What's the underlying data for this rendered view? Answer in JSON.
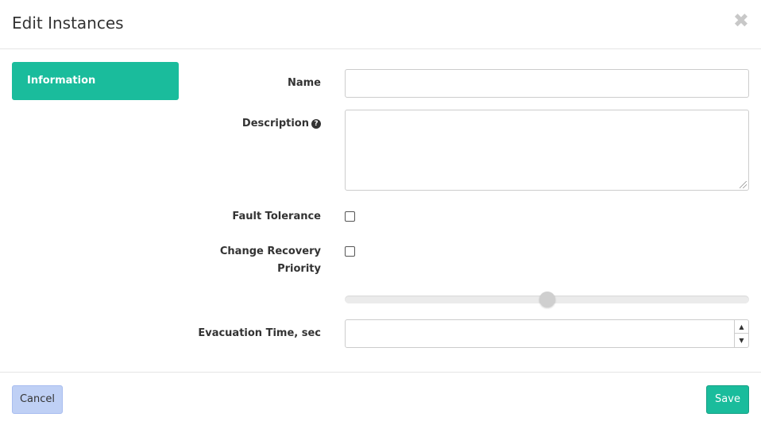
{
  "modal": {
    "title": "Edit Instances",
    "close_glyph": "✖"
  },
  "sidebar": {
    "tabs": [
      {
        "label": "Information",
        "active": true
      }
    ]
  },
  "form": {
    "name": {
      "label": "Name",
      "value": ""
    },
    "description": {
      "label": "Description",
      "help_icon": "question-circle-icon",
      "value": ""
    },
    "fault_tolerance": {
      "label": "Fault Tolerance",
      "checked": false
    },
    "change_recovery_priority": {
      "label_line1": "Change Recovery",
      "label_line2": "Priority",
      "checked": false
    },
    "recovery_priority_slider": {
      "level_fraction": 0.5
    },
    "evacuation_time": {
      "label": "Evacuation Time, sec",
      "value": "",
      "up_glyph": "▲",
      "down_glyph": "▼"
    }
  },
  "footer": {
    "cancel_label": "Cancel",
    "save_label": "Save"
  },
  "colors": {
    "accent": "#1abc9c",
    "cancel_bg": "#bfd0f5"
  }
}
